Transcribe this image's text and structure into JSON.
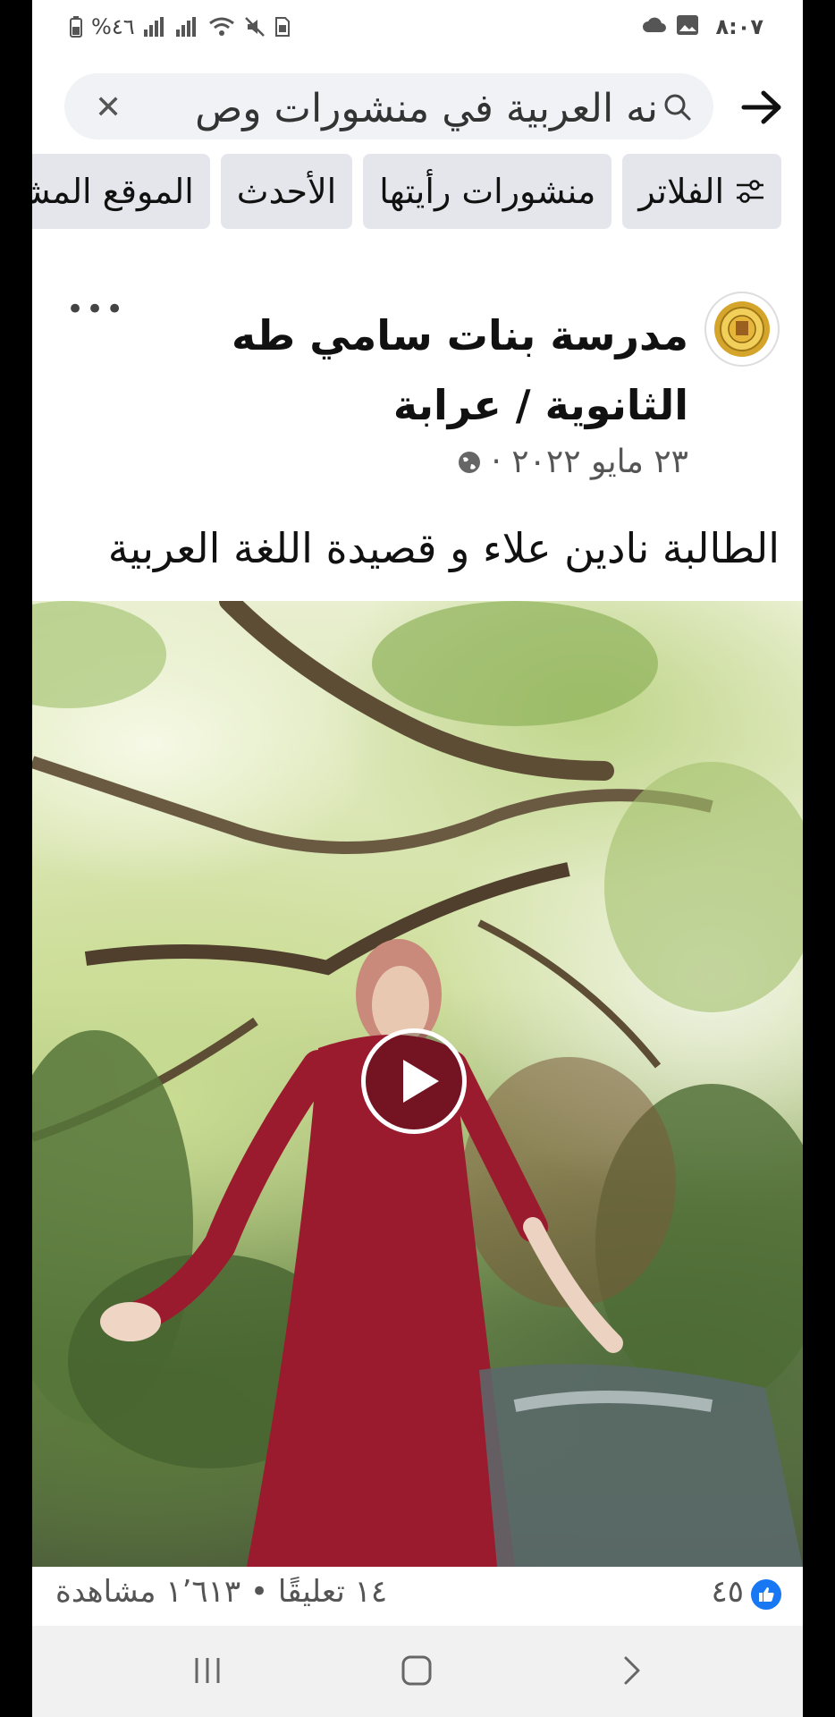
{
  "status_bar": {
    "time": "٨:٠٧",
    "battery_percent": "%٤٦"
  },
  "search": {
    "query": "نه العربية في منشورات وص"
  },
  "filters": [
    {
      "label": "الفلاتر",
      "icon": "sliders-icon"
    },
    {
      "label": "منشورات رأيتها"
    },
    {
      "label": "الأحدث"
    },
    {
      "label": "الموقع المشا"
    }
  ],
  "post": {
    "author_line1": "مدرسة بنات سامي طه",
    "author_line2": "الثانوية / عرابة",
    "date": "٢٣ مايو ٢٠٢٢ ·",
    "text": "الطالبة نادين علاء و قصيدة اللغة العربية"
  },
  "stats": {
    "likes": "٤٥",
    "comments_views": "١٤ تعليقًا • ١٬٦١٣ مشاهدة"
  },
  "colors": {
    "accent": "#1877f2",
    "chip_bg": "#e4e6eb",
    "dress": "#9b1b2e"
  }
}
